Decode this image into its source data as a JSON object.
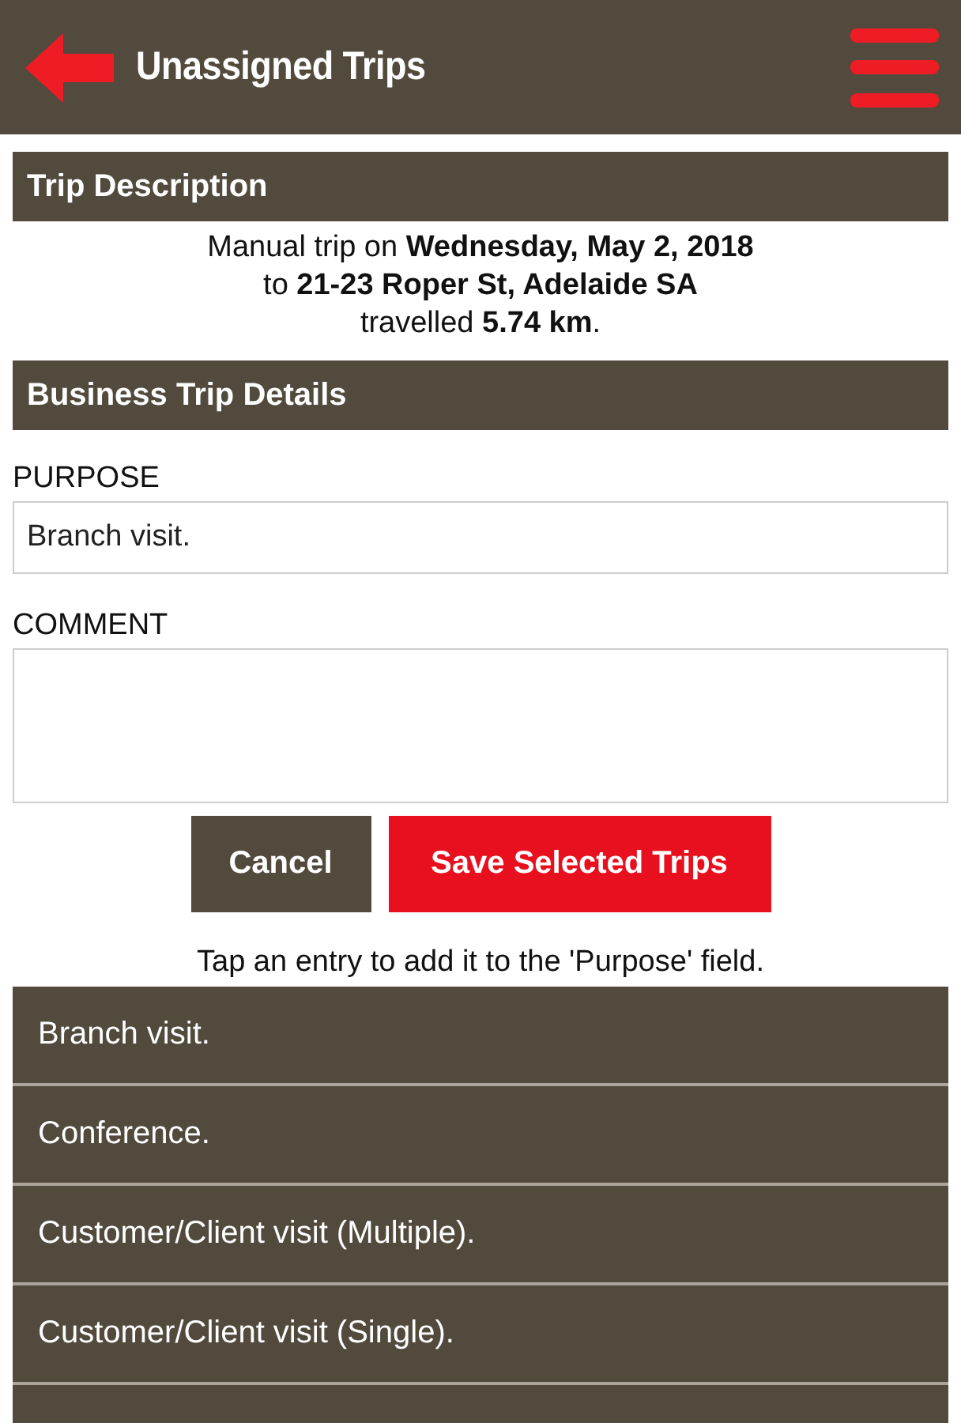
{
  "header": {
    "title": "Unassigned Trips"
  },
  "trip_description": {
    "heading": "Trip Description",
    "lines": [
      "Manual trip on **Wednesday, May 2, 2018**",
      "to **21-23 Roper St, Adelaide SA**",
      "travelled **5.74 km**."
    ]
  },
  "business_trip_details": {
    "heading": "Business Trip Details",
    "purpose": {
      "label": "PURPOSE",
      "value": "Branch visit."
    },
    "comment": {
      "label": "COMMENT"
    }
  },
  "buttons": [
    {
      "label": "Cancel",
      "kind": "secondary"
    },
    {
      "label": "Save Selected Trips",
      "kind": "primary"
    }
  ],
  "hint": "Tap an entry to add it to the 'Purpose' field.",
  "purposes": [
    "Branch visit.",
    "Conference.",
    "Customer/Client visit (Multiple).",
    "Customer/Client visit (Single)."
  ]
}
